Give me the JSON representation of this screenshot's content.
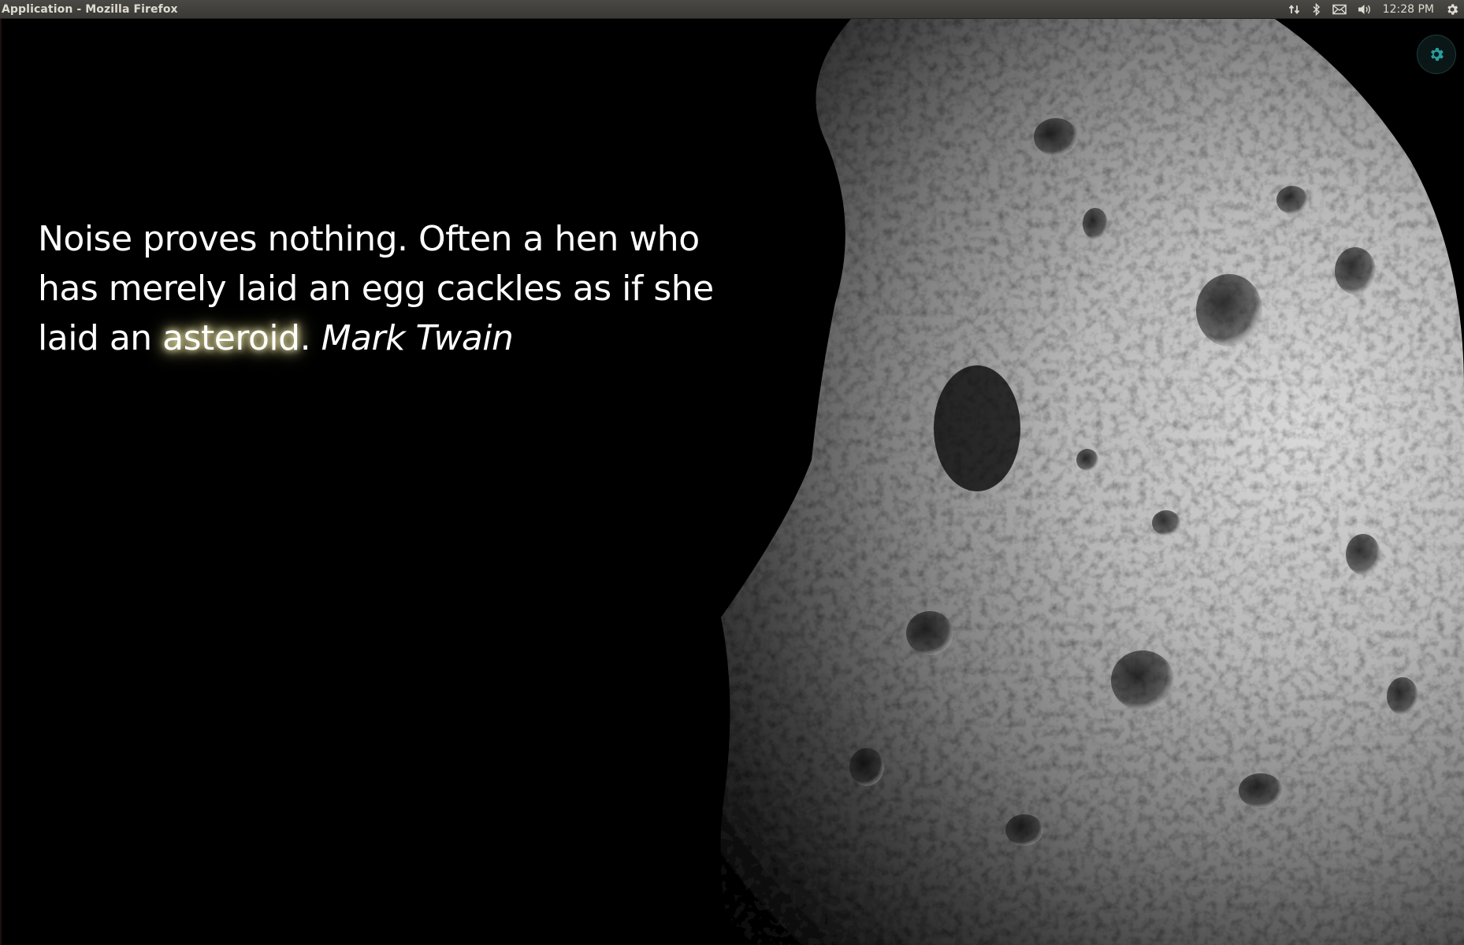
{
  "window": {
    "title": "Application - Mozilla Firefox"
  },
  "indicators": {
    "network_icon": "network-updown-icon",
    "bluetooth_icon": "bluetooth-icon",
    "mail_icon": "mail-icon",
    "volume_icon": "volume-icon",
    "clock": "12:28 PM",
    "session_icon": "gear-icon"
  },
  "quote": {
    "line_prefix": "Noise proves nothing. Often a hen who has merely laid an egg cackles as if she laid an ",
    "keyword": "asteroid",
    "punctuation": ".",
    "author": "Mark Twain"
  },
  "settings": {
    "icon": "gear-icon",
    "accent_color": "#2a9d9d"
  },
  "colors": {
    "background": "#000000",
    "text": "#ffffff",
    "keyword_glow": "#f4f0b8",
    "topbar": "#3e3d39"
  }
}
